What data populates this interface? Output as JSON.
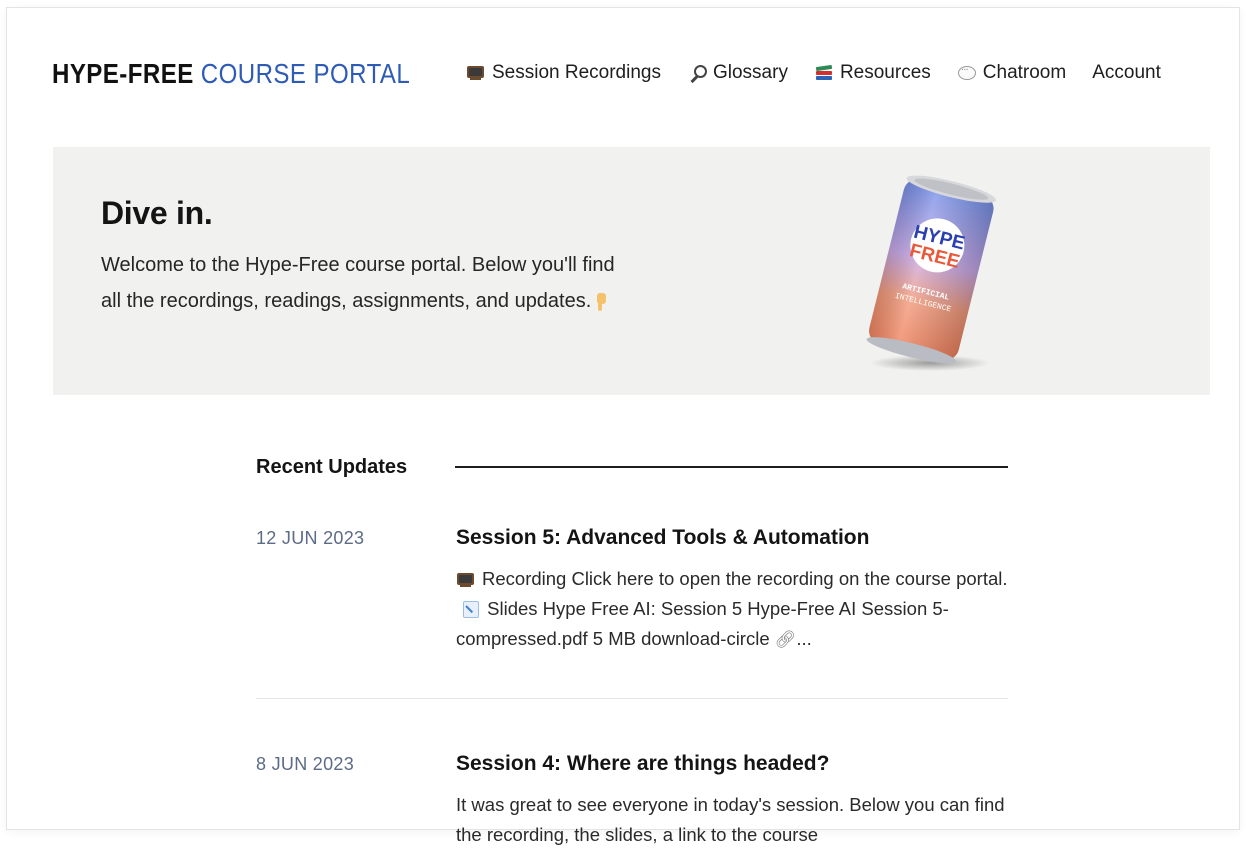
{
  "header": {
    "logo_bold": "HYPE-FREE",
    "logo_light": "COURSE PORTAL",
    "nav": [
      {
        "label": "Session Recordings",
        "icon": "television-icon"
      },
      {
        "label": "Glossary",
        "icon": "magnifier-icon"
      },
      {
        "label": "Resources",
        "icon": "books-icon"
      },
      {
        "label": "Chatroom",
        "icon": "speech-bubble-icon"
      },
      {
        "label": "Account",
        "icon": ""
      }
    ]
  },
  "hero": {
    "title": "Dive in.",
    "text": "Welcome to the Hype-Free course portal. Below you'll find all the recordings, readings, assignments, and updates.",
    "can": {
      "brand_line1": "HYPE",
      "brand_line2": "FREE",
      "sub_line1": "ARTIFICIAL",
      "sub_line2": "INTELLIGENCE"
    }
  },
  "updates": {
    "heading": "Recent Updates",
    "items": [
      {
        "date": "12 JUN 2023",
        "title": "Session 5: Advanced Tools & Automation",
        "recording_text": "Recording Click here to open the recording on the course portal.",
        "slides_text": "Slides Hype Free AI: Session 5 Hype-Free AI Session 5-compressed.pdf 5 MB download-circle",
        "trailing": "..."
      },
      {
        "date": "8 JUN 2023",
        "title": "Session 4: Where are things headed?",
        "body": "It was great to see everyone in today's session. Below you can find the recording, the slides, a link to the course"
      }
    ]
  },
  "colors": {
    "accent_blue": "#2d5bb6",
    "date_gray": "#5c6b86",
    "hero_bg": "#f1f1f0"
  }
}
